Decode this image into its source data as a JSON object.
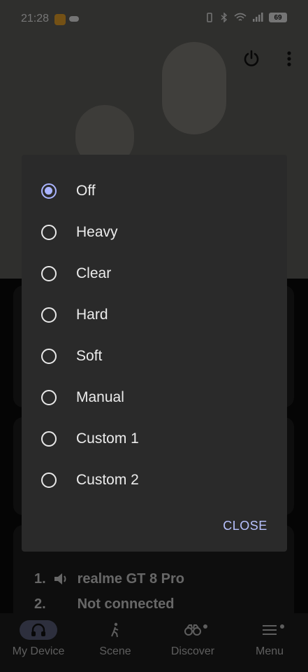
{
  "status_bar": {
    "time": "21:28",
    "battery": "69"
  },
  "devices": [
    {
      "number": "1.",
      "name": "realme GT 8 Pro"
    },
    {
      "number": "2.",
      "name": "Not connected"
    }
  ],
  "bottom_nav": [
    {
      "label": "My Device",
      "icon": "headphones-icon",
      "active": true
    },
    {
      "label": "Scene",
      "icon": "walking-icon",
      "active": false
    },
    {
      "label": "Discover",
      "icon": "binoculars-icon",
      "active": false
    },
    {
      "label": "Menu",
      "icon": "menu-icon",
      "active": false
    }
  ],
  "dialog": {
    "options": [
      {
        "label": "Off",
        "selected": true
      },
      {
        "label": "Heavy",
        "selected": false
      },
      {
        "label": "Clear",
        "selected": false
      },
      {
        "label": "Hard",
        "selected": false
      },
      {
        "label": "Soft",
        "selected": false
      },
      {
        "label": "Manual",
        "selected": false
      },
      {
        "label": "Custom 1",
        "selected": false
      },
      {
        "label": "Custom 2",
        "selected": false
      }
    ],
    "close_label": "CLOSE"
  },
  "colors": {
    "accent": "#aab4ff",
    "dialog_bg": "#2a2a2a",
    "nav_active": "#5a5f7a"
  }
}
